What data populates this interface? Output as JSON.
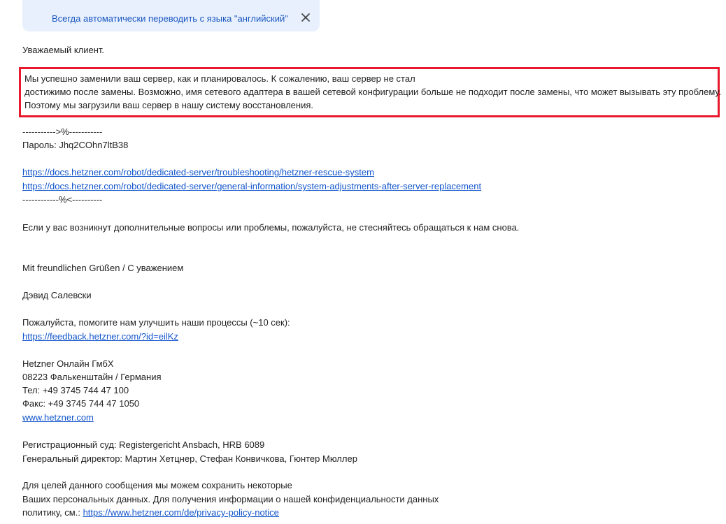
{
  "translate_bar": {
    "text": "Всегда автоматически переводить с языка \"английский\"",
    "close_icon": "close-icon"
  },
  "email": {
    "greeting": "Уважаемый клиент.",
    "highlighted": [
      "Мы успешно заменили ваш сервер, как и планировалось. К сожалению, ваш сервер не стал",
      "достижимо после замены. Возможно, имя сетевого адаптера в вашей сетевой конфигурации больше не подходит после замены, что может вызывать эту проблему.",
      "Поэтому мы загрузили ваш сервер в нашу систему восстановления."
    ],
    "cut_start": "----------->%-----------",
    "password": "Пароль: Jhq2COhn7ltB38",
    "link_rescue": "https://docs.hetzner.com/robot/dedicated-server/troubleshooting/hetzner-rescue-system",
    "link_adjust": "https://docs.hetzner.com/robot/dedicated-server/general-information/system-adjustments-after-server-replacement",
    "cut_end": "------------%<----------",
    "questions": "Если у вас возникнут дополнительные вопросы или проблемы, пожалуйста, не стесняйтесь обращаться к нам снова.",
    "regards": "Mit freundlichen Grüßen / С уважением",
    "signature_name": "Дэвид Салевски",
    "feedback_text": "Пожалуйста, помогите нам улучшить наши процессы (~10 сек):",
    "feedback_link": "https://feedback.hetzner.com/?id=eilKz",
    "company": "Hetzner Онлайн ГмбХ",
    "address": "08223 Фалькенштайн / Германия",
    "phone": "Тел: +49 3745 744 47 100",
    "fax": "Факс: +49 3745 744 47 1050",
    "website": "www.hetzner.com",
    "register": "Регистрационный суд: Registergericht Ansbach, HRB 6089",
    "director": "Генеральный директор: Мартин Хетцнер, Стефан Конвичкова, Гюнтер Мюллер",
    "privacy_1": "Для целей данного сообщения мы можем сохранить некоторые",
    "privacy_2": "Ваших персональных данных. Для получения информации о нашей конфиденциальности данных",
    "privacy_3_prefix": "политику, см.: ",
    "privacy_link": "https://www.hetzner.com/de/privacy-policy-notice"
  },
  "colors": {
    "link": "#1155cc",
    "translate_bg": "#e8f0fe",
    "highlight_border": "#e8192c"
  }
}
